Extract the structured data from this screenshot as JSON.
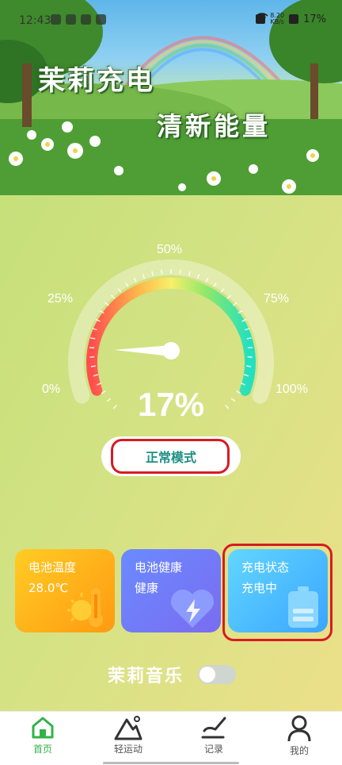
{
  "status_bar": {
    "time": "12:43",
    "net_speed_value": "8.20",
    "net_speed_unit": "KB/s",
    "battery_percent": "17%"
  },
  "banner": {
    "title": "茉莉充电",
    "subtitle": "清新能量"
  },
  "gauge": {
    "level_percent": 17,
    "display_value": "17%",
    "tick_labels": [
      "0%",
      "25%",
      "50%",
      "75%",
      "100%"
    ]
  },
  "mode_button": {
    "label": "正常模式"
  },
  "cards": {
    "temperature": {
      "title": "电池温度",
      "value": "28.0℃"
    },
    "health": {
      "title": "电池健康",
      "value": "健康"
    },
    "charge_state": {
      "title": "充电状态",
      "value": "充电中"
    }
  },
  "music": {
    "label": "茉莉音乐",
    "enabled": false
  },
  "tabbar": {
    "items": [
      {
        "label": "首页",
        "icon": "home-icon",
        "active": true
      },
      {
        "label": "轻运动",
        "icon": "mountain-icon",
        "active": false
      },
      {
        "label": "记录",
        "icon": "pen-record-icon",
        "active": false
      },
      {
        "label": "我的",
        "icon": "person-icon",
        "active": false
      }
    ]
  },
  "colors": {
    "accent_green": "#33b24a",
    "highlight_red": "#d71b22",
    "mode_text": "#1e8f84"
  }
}
